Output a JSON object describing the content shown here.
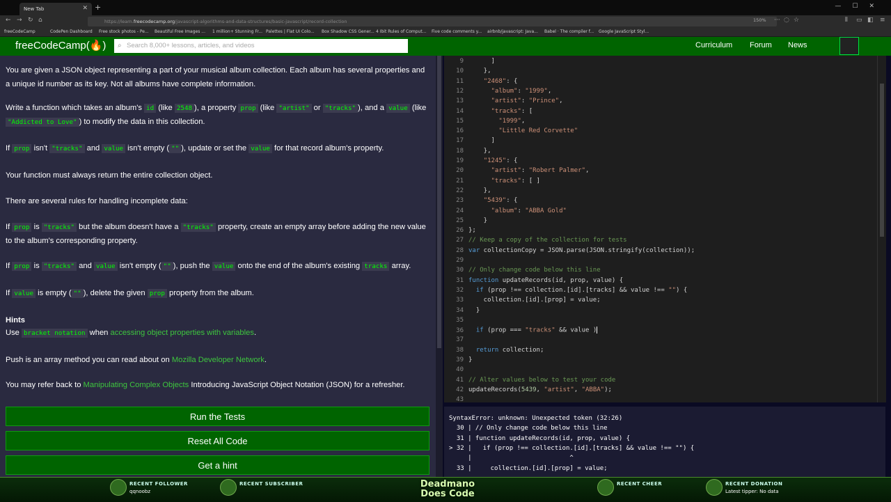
{
  "browser": {
    "tab_title": "New Tab",
    "url_prefix": "https://learn.",
    "url_host": "freecodecamp.org",
    "url_path": "/javascript-algorithms-and-data-structures/basic-javascript/record-collection",
    "zoom": "150%",
    "bookmarks": [
      "freeCodeCamp",
      "CodePen Dashboard",
      "Free stock photos - Pe...",
      "Beautiful Free Images ...",
      "1 million+ Stunning Fr...",
      "Palettes | Flat UI Colo...",
      "Box Shadow CSS Gener...",
      "4 Ibit Rules of Comput...",
      "Five code comments y...",
      "airbnb/javascript: Java...",
      "Babel · The compiler f...",
      "Google JavaScript Styl..."
    ]
  },
  "fcc_nav": {
    "logo": "freeCodeCamp(🔥)",
    "search_placeholder": "Search 8,000+ lessons, articles, and videos",
    "links": [
      "Curriculum",
      "Forum",
      "News"
    ]
  },
  "challenge": {
    "p1": "You are given a JSON object representing a part of your musical album collection. Each album has several properties and a unique id number as its key. Not all albums have complete information.",
    "p2_a": "Write a function which takes an album's ",
    "p2_id": "id",
    "p2_b": " (like ",
    "p2_2548": "2548",
    "p2_c": "), a property ",
    "p2_prop": "prop",
    "p2_d": " (like ",
    "p2_artist": "\"artist\"",
    "p2_e": " or ",
    "p2_tracks": "\"tracks\"",
    "p2_f": "), and a ",
    "p2_value": "value",
    "p2_g": " (like ",
    "p2_addicted": "\"Addicted to Love\"",
    "p2_h": ") to modify the data in this collection.",
    "p3_a": "If ",
    "p3_prop": "prop",
    "p3_b": " isn't ",
    "p3_tracks": "\"tracks\"",
    "p3_c": " and ",
    "p3_value": "value",
    "p3_d": " isn't empty (",
    "p3_empty": "\"\"",
    "p3_e": "), update or set the ",
    "p3_value2": "value",
    "p3_f": " for that record album's property.",
    "p4": "Your function must always return the entire collection object.",
    "p5": "There are several rules for handling incomplete data:",
    "p6_a": "If ",
    "p6_prop": "prop",
    "p6_b": " is ",
    "p6_tracks": "\"tracks\"",
    "p6_c": " but the album doesn't have a ",
    "p6_tracks2": "\"tracks\"",
    "p6_d": " property, create an empty array before adding the new value to the album's corresponding property.",
    "p7_a": "If ",
    "p7_prop": "prop",
    "p7_b": " is ",
    "p7_tracks": "\"tracks\"",
    "p7_c": " and ",
    "p7_value": "value",
    "p7_d": " isn't empty (",
    "p7_empty": "\"\"",
    "p7_e": "), push the ",
    "p7_value2": "value",
    "p7_f": " onto the end of the album's existing ",
    "p7_tracks2": "tracks",
    "p7_g": " array.",
    "p8_a": "If ",
    "p8_value": "value",
    "p8_b": " is empty (",
    "p8_empty": "\"\"",
    "p8_c": "), delete the given ",
    "p8_prop": "prop",
    "p8_d": " property from the album.",
    "hints_title": "Hints",
    "h1_a": "Use ",
    "h1_code": "bracket notation",
    "h1_b": " when ",
    "h1_link": "accessing object properties with variables",
    "h1_c": ".",
    "h2_a": "Push is an array method you can read about on ",
    "h2_link": "Mozilla Developer Network",
    "h2_b": ".",
    "h3_a": "You may refer back to ",
    "h3_link": "Manipulating Complex Objects",
    "h3_b": " Introducing JavaScript Object Notation (JSON) for a refresher."
  },
  "buttons": {
    "run": "Run the Tests",
    "reset": "Reset All Code",
    "hint": "Get a hint"
  },
  "editor_lines": [
    {
      "n": "9",
      "t": "      ]"
    },
    {
      "n": "10",
      "t": "    },"
    },
    {
      "n": "11",
      "t": "    \"2468\": {"
    },
    {
      "n": "12",
      "t": "      \"album\": \"1999\","
    },
    {
      "n": "13",
      "t": "      \"artist\": \"Prince\","
    },
    {
      "n": "14",
      "t": "      \"tracks\": ["
    },
    {
      "n": "15",
      "t": "        \"1999\","
    },
    {
      "n": "16",
      "t": "        \"Little Red Corvette\""
    },
    {
      "n": "17",
      "t": "      ]"
    },
    {
      "n": "18",
      "t": "    },"
    },
    {
      "n": "19",
      "t": "    \"1245\": {"
    },
    {
      "n": "20",
      "t": "      \"artist\": \"Robert Palmer\","
    },
    {
      "n": "21",
      "t": "      \"tracks\": [ ]"
    },
    {
      "n": "22",
      "t": "    },"
    },
    {
      "n": "23",
      "t": "    \"5439\": {"
    },
    {
      "n": "24",
      "t": "      \"album\": \"ABBA Gold\""
    },
    {
      "n": "25",
      "t": "    }"
    },
    {
      "n": "26",
      "t": "};"
    },
    {
      "n": "27",
      "t": "// Keep a copy of the collection for tests"
    },
    {
      "n": "28",
      "t": "var collectionCopy = JSON.parse(JSON.stringify(collection));"
    },
    {
      "n": "29",
      "t": ""
    },
    {
      "n": "30",
      "t": "// Only change code below this line"
    },
    {
      "n": "31",
      "t": "function updateRecords(id, prop, value) {"
    },
    {
      "n": "32",
      "t": "  if (prop !== collection.[id].[tracks] && value !== \"\") {"
    },
    {
      "n": "33",
      "t": "    collection.[id].[prop] = value;"
    },
    {
      "n": "34",
      "t": "  }"
    },
    {
      "n": "35",
      "t": ""
    },
    {
      "n": "36",
      "t": "  if (prop === \"tracks\" && value )"
    },
    {
      "n": "37",
      "t": ""
    },
    {
      "n": "38",
      "t": "  return collection;"
    },
    {
      "n": "39",
      "t": "}"
    },
    {
      "n": "40",
      "t": ""
    },
    {
      "n": "41",
      "t": "// Alter values below to test your code"
    },
    {
      "n": "42",
      "t": "updateRecords(5439, \"artist\", \"ABBA\");"
    },
    {
      "n": "43",
      "t": ""
    }
  ],
  "output_lines": [
    "SyntaxError: unknown: Unexpected token (32:26)",
    "  30 | // Only change code below this line",
    "  31 | function updateRecords(id, prop, value) {",
    "> 32 |   if (prop !== collection.[id].[tracks] && value !== \"\") {",
    "     |                          ^",
    "  33 |     collection.[id].[prop] = value;"
  ],
  "overlay": {
    "follower_label": "RECENT FOLLOWER",
    "follower_name": "qqnoobz",
    "subscriber_label": "RECENT SUBSCRIBER",
    "brand_1": "Deadmano",
    "brand_2": "Does Code",
    "cheer_label": "RECENT CHEER",
    "donation_label": "RECENT DONATION",
    "donation_value": "Latest tipper: No data"
  }
}
